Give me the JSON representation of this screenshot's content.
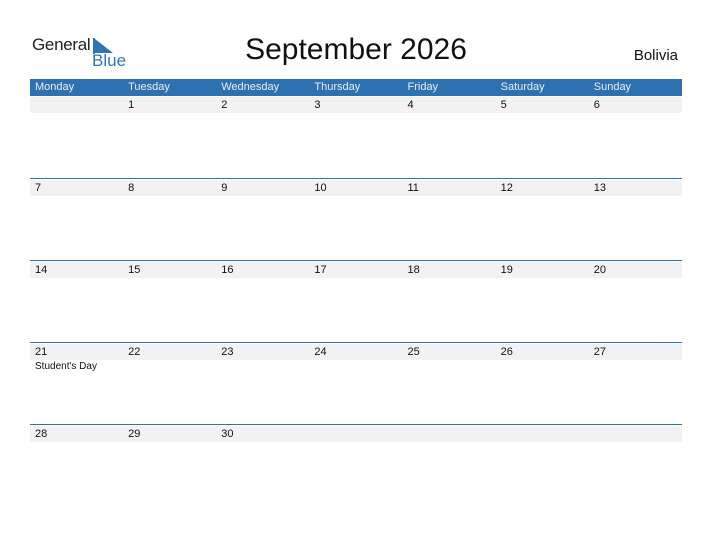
{
  "logo": {
    "general": "General",
    "blue": "Blue"
  },
  "title": "September 2026",
  "country": "Bolivia",
  "colors": {
    "accent": "#2e71b1",
    "strip": "#f2f2f2"
  },
  "weekdays": [
    "Monday",
    "Tuesday",
    "Wednesday",
    "Thursday",
    "Friday",
    "Saturday",
    "Sunday"
  ],
  "weeks": [
    {
      "days": [
        "",
        "1",
        "2",
        "3",
        "4",
        "5",
        "6"
      ],
      "events": [
        "",
        "",
        "",
        "",
        "",
        "",
        ""
      ]
    },
    {
      "days": [
        "7",
        "8",
        "9",
        "10",
        "11",
        "12",
        "13"
      ],
      "events": [
        "",
        "",
        "",
        "",
        "",
        "",
        ""
      ]
    },
    {
      "days": [
        "14",
        "15",
        "16",
        "17",
        "18",
        "19",
        "20"
      ],
      "events": [
        "",
        "",
        "",
        "",
        "",
        "",
        ""
      ]
    },
    {
      "days": [
        "21",
        "22",
        "23",
        "24",
        "25",
        "26",
        "27"
      ],
      "events": [
        "Student's Day",
        "",
        "",
        "",
        "",
        "",
        ""
      ]
    },
    {
      "days": [
        "28",
        "29",
        "30",
        "",
        "",
        "",
        ""
      ],
      "events": [
        "",
        "",
        "",
        "",
        "",
        "",
        ""
      ]
    }
  ]
}
